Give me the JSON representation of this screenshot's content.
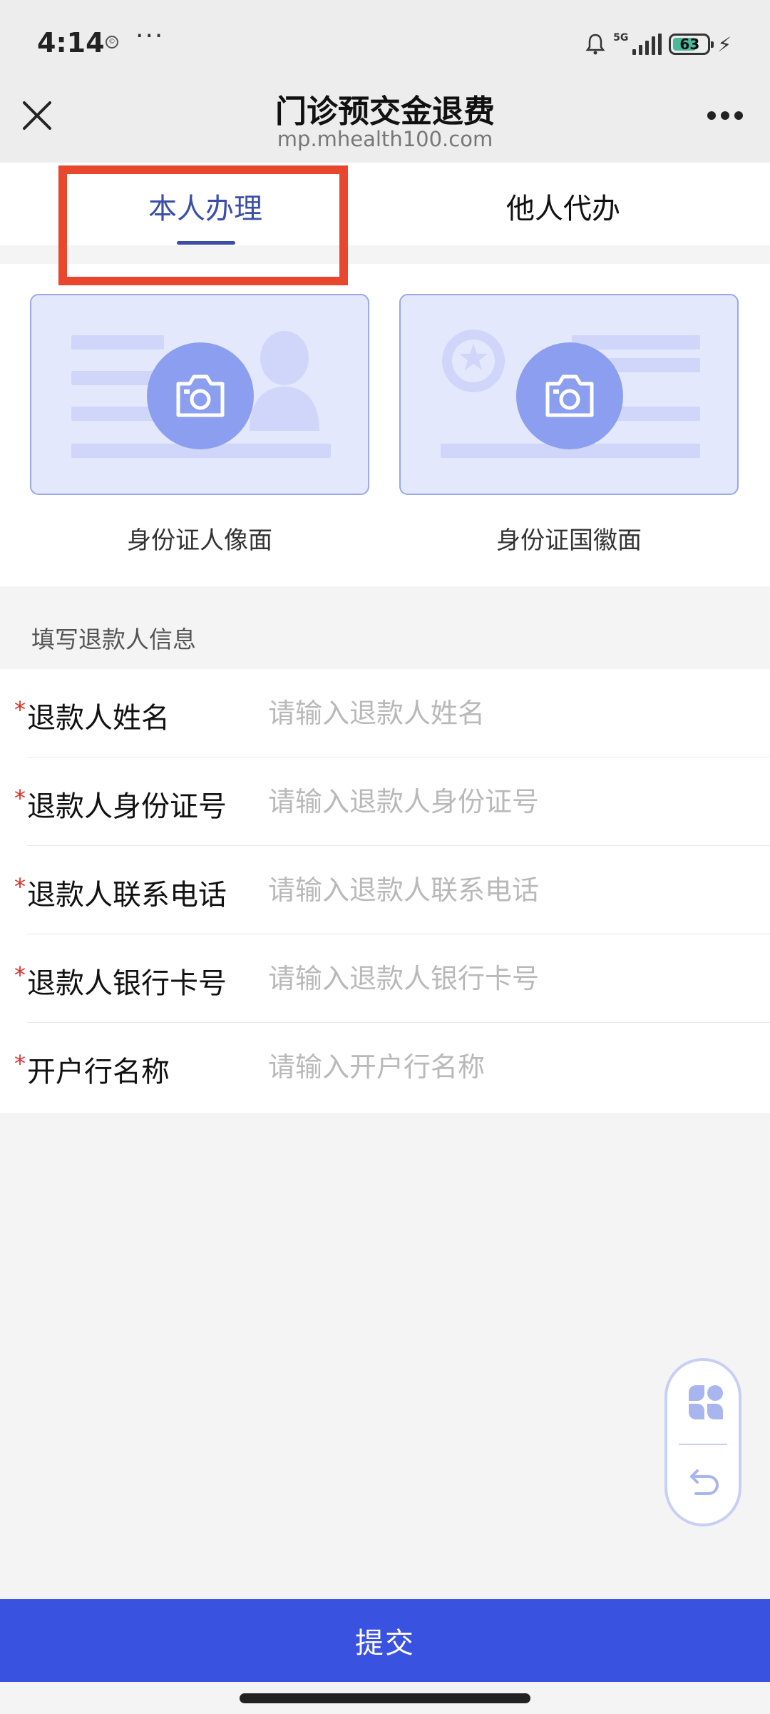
{
  "status_bar": {
    "time": "4:14",
    "small_icon_glyph": "©",
    "overflow_dots": "···",
    "network_type": "5G",
    "battery_level": "63",
    "charging_glyph": "⚡"
  },
  "nav": {
    "title": "门诊预交金退费",
    "subtitle": "mp.mhealth100.com"
  },
  "tabs": [
    {
      "label": "本人办理",
      "active": true
    },
    {
      "label": "他人代办",
      "active": false
    }
  ],
  "id_upload": {
    "front_caption": "身份证人像面",
    "back_caption": "身份证国徽面"
  },
  "form": {
    "section_title": "填写退款人信息",
    "required_mark": "*",
    "fields": [
      {
        "label": "退款人姓名",
        "placeholder": "请输入退款人姓名",
        "value": ""
      },
      {
        "label": "退款人身份证号",
        "placeholder": "请输入退款人身份证号",
        "value": ""
      },
      {
        "label": "退款人联系电话",
        "placeholder": "请输入退款人联系电话",
        "value": ""
      },
      {
        "label": "退款人银行卡号",
        "placeholder": "请输入退款人银行卡号",
        "value": ""
      },
      {
        "label": "开户行名称",
        "placeholder": "请输入开户行名称",
        "value": ""
      }
    ]
  },
  "submit_label": "提交",
  "colors": {
    "accent": "#3a52e0",
    "tab_active": "#3b4ea8",
    "highlight_box": "#e8472d",
    "required": "#d9302c",
    "card_bg": "#e4e8fd",
    "camera_circle": "#8c9ef0"
  },
  "icons": [
    "close-icon",
    "more-icon",
    "camera-icon",
    "bell-icon",
    "signal-icon",
    "battery-icon",
    "clover-icon",
    "back-arrow-icon"
  ]
}
